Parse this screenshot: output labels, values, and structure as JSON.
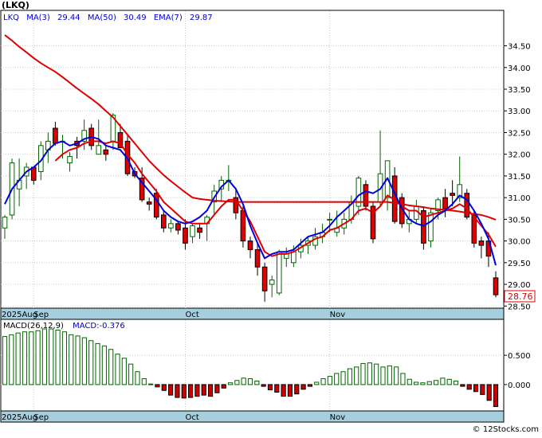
{
  "ticker_title": "(LKQ)",
  "legend": {
    "ticker": "LKQ",
    "ma3_label": "MA(3)",
    "ma3_value": "29.44",
    "ma50_label": "MA(50)",
    "ma50_value": "30.49",
    "ema7_label": "EMA(7)",
    "ema7_value": "29.87"
  },
  "macd_legend": {
    "params": "MACD(26,12,9)",
    "value_label": "MACD:-0.376"
  },
  "last_price_label": "28.76",
  "watermark": "© 12Stocks.com",
  "colors": {
    "up": "#006400",
    "down": "#e00000",
    "ma3": "#0000dd",
    "ma50": "#dd0000",
    "ema7": "#dd0000",
    "axis_band": "#a6cede",
    "macd_pos": "#006400",
    "macd_neg": "#cc0000"
  },
  "chart_data": {
    "type": "candlestick",
    "price_axis": {
      "ticks": [
        "28.50",
        "29.00",
        "29.50",
        "30.00",
        "30.50",
        "31.00",
        "31.50",
        "32.00",
        "32.50",
        "33.00",
        "33.50",
        "34.00",
        "34.50"
      ],
      "ylim": [
        28.45,
        35.3
      ]
    },
    "macd_axis": {
      "ticks": [
        "0.500",
        "0.000"
      ],
      "ylim": [
        -0.45,
        1.1
      ]
    },
    "x_labels": [
      {
        "label": "2025Aug",
        "index": -0.5
      },
      {
        "label": "Sep",
        "index": 4
      },
      {
        "label": "Oct",
        "index": 25
      },
      {
        "label": "Nov",
        "index": 45
      }
    ],
    "candles": [
      [
        30.3,
        30.6,
        30.05,
        30.55
      ],
      [
        30.6,
        31.9,
        30.5,
        31.8
      ],
      [
        31.2,
        31.9,
        30.8,
        31.4
      ],
      [
        31.5,
        31.8,
        31.2,
        31.7
      ],
      [
        31.7,
        31.5,
        31.3,
        31.4
      ],
      [
        31.6,
        32.3,
        31.4,
        32.2
      ],
      [
        32.1,
        32.5,
        31.8,
        32.3
      ],
      [
        32.6,
        32.75,
        32.2,
        32.25
      ],
      [
        32.3,
        32.45,
        31.9,
        32.3
      ],
      [
        31.8,
        32.05,
        31.6,
        31.95
      ],
      [
        32.3,
        32.4,
        31.9,
        32.2
      ],
      [
        32.3,
        32.8,
        32.1,
        32.55
      ],
      [
        32.6,
        32.7,
        32.1,
        32.2
      ],
      [
        32.0,
        32.8,
        32.0,
        32.2
      ],
      [
        32.1,
        32.2,
        31.85,
        32.0
      ],
      [
        32.3,
        32.95,
        32.1,
        32.9
      ],
      [
        32.5,
        32.7,
        32.3,
        32.15
      ],
      [
        32.3,
        32.45,
        31.5,
        31.55
      ],
      [
        31.6,
        31.7,
        31.45,
        31.5
      ],
      [
        31.45,
        31.7,
        30.9,
        30.95
      ],
      [
        30.9,
        31.0,
        30.7,
        30.85
      ],
      [
        31.1,
        31.2,
        30.5,
        30.55
      ],
      [
        30.6,
        30.7,
        30.2,
        30.3
      ],
      [
        30.3,
        30.5,
        30.2,
        30.4
      ],
      [
        30.4,
        30.45,
        30.15,
        30.25
      ],
      [
        30.3,
        30.5,
        29.8,
        29.95
      ],
      [
        30.1,
        30.4,
        29.95,
        30.35
      ],
      [
        30.3,
        30.4,
        30.05,
        30.2
      ],
      [
        30.4,
        30.6,
        30.0,
        30.55
      ],
      [
        30.9,
        31.3,
        30.6,
        31.15
      ],
      [
        31.2,
        31.5,
        30.9,
        31.4
      ],
      [
        31.4,
        31.75,
        31.15,
        31.4
      ],
      [
        31.0,
        31.2,
        30.5,
        30.65
      ],
      [
        30.7,
        30.8,
        29.85,
        30.0
      ],
      [
        30.0,
        30.1,
        29.6,
        29.8
      ],
      [
        29.8,
        29.95,
        29.2,
        29.4
      ],
      [
        29.4,
        29.5,
        28.6,
        28.85
      ],
      [
        29.0,
        29.2,
        28.7,
        29.1
      ],
      [
        28.8,
        29.8,
        28.75,
        29.75
      ],
      [
        29.6,
        29.85,
        29.4,
        29.7
      ],
      [
        29.5,
        29.9,
        29.4,
        29.75
      ],
      [
        29.75,
        30.05,
        29.6,
        29.9
      ],
      [
        29.9,
        30.1,
        29.7,
        30.0
      ],
      [
        29.9,
        30.3,
        29.8,
        30.1
      ],
      [
        30.1,
        30.4,
        29.95,
        30.2
      ],
      [
        30.5,
        30.65,
        30.2,
        30.5
      ],
      [
        30.2,
        30.7,
        30.1,
        30.3
      ],
      [
        30.3,
        30.65,
        30.15,
        30.5
      ],
      [
        30.5,
        31.05,
        30.4,
        30.9
      ],
      [
        30.8,
        31.5,
        30.6,
        31.45
      ],
      [
        31.3,
        31.4,
        30.7,
        30.8
      ],
      [
        30.8,
        30.9,
        29.95,
        30.05
      ],
      [
        30.9,
        32.55,
        30.8,
        31.55
      ],
      [
        31.0,
        31.6,
        30.7,
        31.85
      ],
      [
        31.5,
        31.7,
        30.4,
        30.45
      ],
      [
        31.0,
        31.1,
        30.3,
        30.4
      ],
      [
        30.4,
        30.7,
        30.2,
        30.5
      ],
      [
        30.5,
        30.95,
        30.4,
        30.8
      ],
      [
        30.7,
        30.8,
        29.8,
        29.95
      ],
      [
        30.0,
        30.75,
        29.85,
        30.65
      ],
      [
        30.7,
        31.0,
        30.5,
        30.95
      ],
      [
        31.0,
        31.2,
        30.55,
        30.75
      ],
      [
        31.1,
        31.4,
        30.8,
        31.05
      ],
      [
        31.0,
        31.95,
        30.9,
        31.3
      ],
      [
        31.1,
        31.2,
        30.5,
        30.55
      ],
      [
        30.6,
        30.7,
        29.85,
        29.95
      ],
      [
        30.0,
        30.1,
        29.6,
        29.9
      ],
      [
        30.0,
        30.2,
        29.4,
        29.65
      ],
      [
        29.15,
        29.3,
        28.7,
        28.76
      ]
    ],
    "ma3": [
      30.85,
      31.2,
      31.4,
      31.6,
      31.7,
      31.85,
      32.1,
      32.25,
      32.3,
      32.2,
      32.25,
      32.35,
      32.4,
      32.35,
      32.2,
      32.15,
      32.1,
      31.9,
      31.55,
      31.35,
      31.15,
      30.95,
      30.7,
      30.55,
      30.45,
      30.4,
      30.45,
      30.55,
      30.7,
      31.0,
      31.25,
      31.4,
      31.2,
      30.85,
      30.35,
      29.95,
      29.6,
      29.7,
      29.75,
      29.75,
      29.8,
      29.95,
      30.1,
      30.15,
      30.2,
      30.35,
      30.55,
      30.7,
      30.85,
      31.05,
      31.15,
      31.1,
      31.2,
      31.45,
      31.1,
      30.75,
      30.5,
      30.4,
      30.35,
      30.45,
      30.6,
      30.7,
      30.85,
      31.05,
      30.95,
      30.7,
      30.4,
      30.05,
      29.44
    ],
    "ma50": [
      34.75,
      34.62,
      34.48,
      34.35,
      34.22,
      34.1,
      34.0,
      33.9,
      33.78,
      33.65,
      33.52,
      33.4,
      33.28,
      33.15,
      33.0,
      32.85,
      32.65,
      32.45,
      32.25,
      32.05,
      31.85,
      31.68,
      31.52,
      31.38,
      31.25,
      31.12,
      31.0,
      30.97,
      30.95,
      30.93,
      30.92,
      30.91,
      30.9,
      30.9,
      30.9,
      30.9,
      30.9,
      30.9,
      30.9,
      30.9,
      30.9,
      30.9,
      30.9,
      30.9,
      30.9,
      30.9,
      30.9,
      30.9,
      30.9,
      30.9,
      30.9,
      30.9,
      30.9,
      30.9,
      30.88,
      30.85,
      30.82,
      30.8,
      30.78,
      30.75,
      30.73,
      30.72,
      30.7,
      30.68,
      30.65,
      30.62,
      30.6,
      30.55,
      30.49
    ],
    "ema7": [
      null,
      null,
      null,
      null,
      null,
      null,
      null,
      31.85,
      32.0,
      32.1,
      32.15,
      32.25,
      32.3,
      32.3,
      32.25,
      32.3,
      32.25,
      32.0,
      31.8,
      31.55,
      31.35,
      31.15,
      30.9,
      30.75,
      30.6,
      30.45,
      30.4,
      30.4,
      30.4,
      30.6,
      30.8,
      30.95,
      30.95,
      30.7,
      30.45,
      30.1,
      29.75,
      29.65,
      29.7,
      29.7,
      29.75,
      29.85,
      29.95,
      30.05,
      30.1,
      30.25,
      30.3,
      30.4,
      30.5,
      30.7,
      30.75,
      30.65,
      30.8,
      31.05,
      30.95,
      30.8,
      30.7,
      30.7,
      30.55,
      30.6,
      30.65,
      30.7,
      30.75,
      30.85,
      30.75,
      30.55,
      30.35,
      30.15,
      29.87
    ],
    "macd": [
      0.82,
      0.85,
      0.88,
      0.9,
      0.9,
      0.92,
      0.95,
      0.95,
      0.93,
      0.9,
      0.85,
      0.83,
      0.8,
      0.75,
      0.7,
      0.66,
      0.6,
      0.52,
      0.45,
      0.35,
      0.22,
      0.1,
      0.01,
      -0.04,
      -0.1,
      -0.18,
      -0.22,
      -0.23,
      -0.22,
      -0.2,
      -0.18,
      -0.2,
      -0.14,
      -0.06,
      0.03,
      0.07,
      0.11,
      0.1,
      0.06,
      -0.03,
      -0.09,
      -0.13,
      -0.2,
      -0.2,
      -0.16,
      -0.08,
      -0.03,
      0.04,
      0.1,
      0.14,
      0.19,
      0.22,
      0.27,
      0.3,
      0.36,
      0.37,
      0.35,
      0.3,
      0.32,
      0.3,
      0.19,
      0.09,
      0.04,
      0.03,
      0.05,
      0.07,
      0.11,
      0.09,
      0.06,
      -0.03,
      -0.08,
      -0.12,
      -0.17,
      -0.27,
      -0.376
    ]
  }
}
